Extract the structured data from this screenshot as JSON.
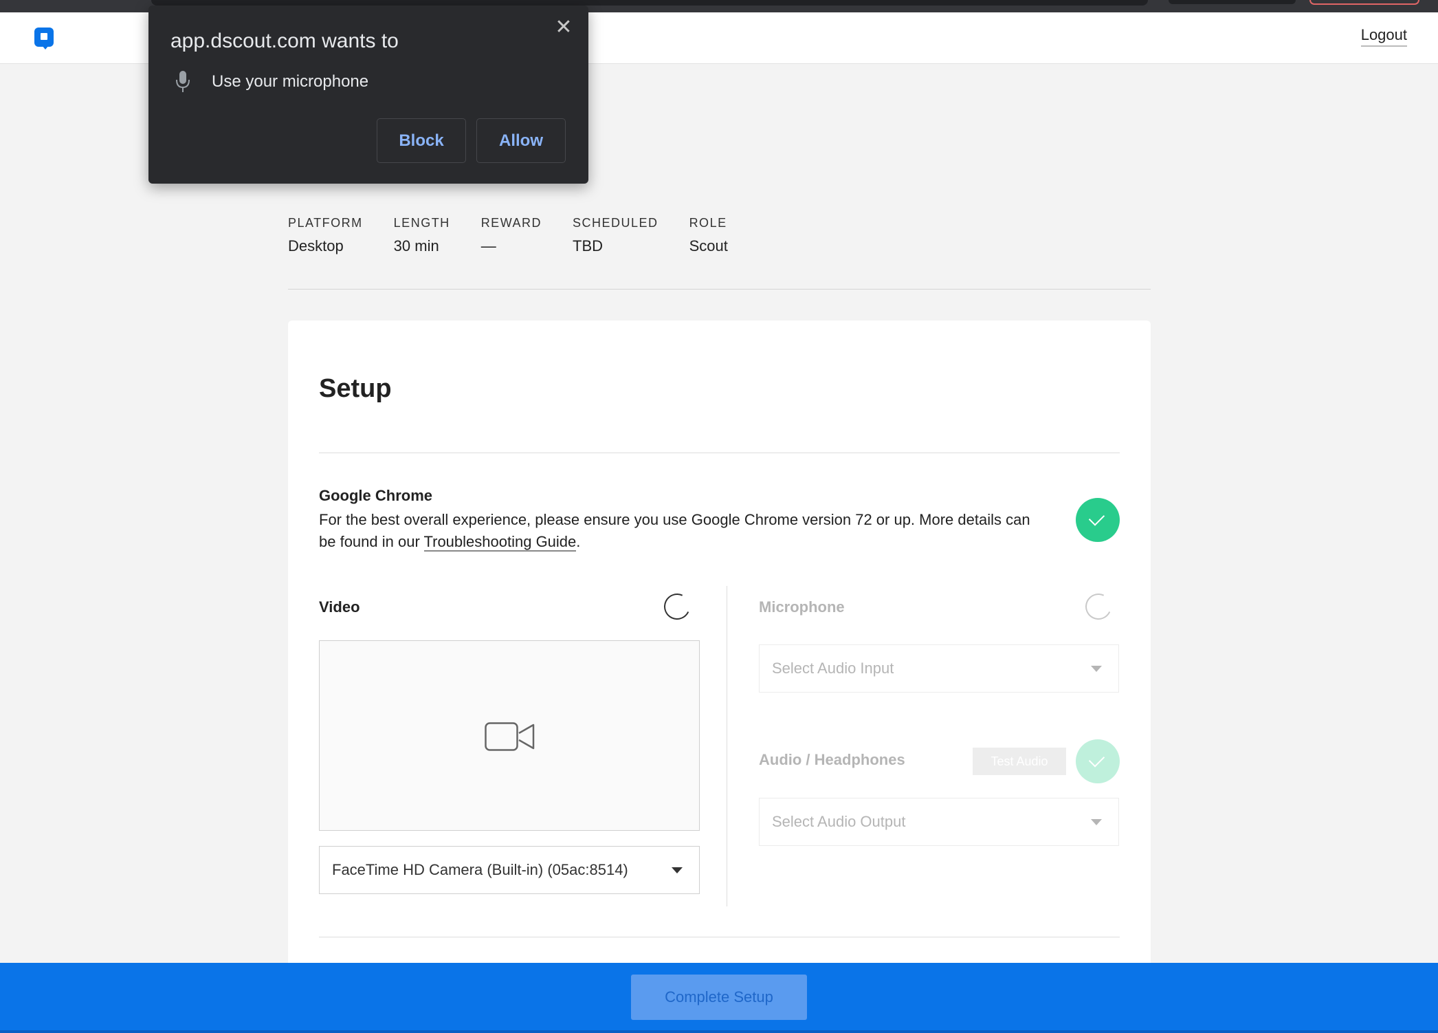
{
  "header": {
    "logout_label": "Logout"
  },
  "permission_popup": {
    "title": "app.dscout.com wants to",
    "permission": "Use your microphone",
    "block_label": "Block",
    "allow_label": "Allow",
    "close_label": "✕"
  },
  "meta": [
    {
      "label": "PLATFORM",
      "value": "Desktop"
    },
    {
      "label": "LENGTH",
      "value": "30 min"
    },
    {
      "label": "REWARD",
      "value": "—"
    },
    {
      "label": "SCHEDULED",
      "value": "TBD"
    },
    {
      "label": "ROLE",
      "value": "Scout"
    }
  ],
  "setup": {
    "title": "Setup",
    "chrome": {
      "title": "Google Chrome",
      "desc_before": "For the best overall experience, please ensure you use Google Chrome version 72 or up. More details can be found in our ",
      "link": "Troubleshooting Guide",
      "desc_after": "."
    },
    "video": {
      "title": "Video",
      "camera_selected": "FaceTime HD Camera (Built-in) (05ac:8514)"
    },
    "microphone": {
      "title": "Microphone",
      "placeholder": "Select Audio Input"
    },
    "audio": {
      "title": "Audio / Headphones",
      "test_label": "Test Audio",
      "placeholder": "Select Audio Output"
    }
  },
  "footer": {
    "complete_label": "Complete Setup"
  },
  "colors": {
    "brand": "#0a74e8",
    "success": "#29cc8c",
    "popup_bg": "#292a2d",
    "popup_link": "#8ab4f8"
  }
}
